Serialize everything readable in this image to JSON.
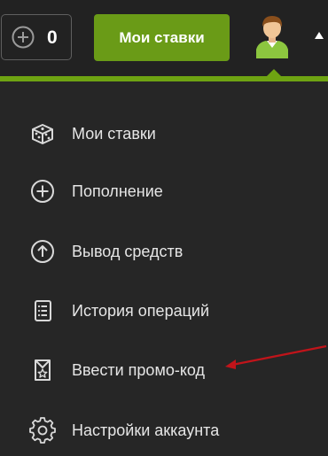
{
  "header": {
    "balance_value": "0",
    "add_funds_icon": "plus-circle-icon",
    "bets_button_label": "Мои ставки",
    "avatar_icon": "user-avatar-icon",
    "dropdown_icon": "caret-up-icon"
  },
  "colors": {
    "accent_green": "#6a9b17",
    "background": "#262626",
    "annotation_arrow": "#c0141a"
  },
  "menu": {
    "items": [
      {
        "label": "Мои ставки",
        "icon": "dice-icon"
      },
      {
        "label": "Пополнение",
        "icon": "plus-circle-icon"
      },
      {
        "label": "Вывод средств",
        "icon": "arrow-up-circle-icon"
      },
      {
        "label": "История операций",
        "icon": "document-list-icon"
      },
      {
        "label": "Ввести промо-код",
        "icon": "star-badge-icon"
      },
      {
        "label": "Настройки аккаунта",
        "icon": "gear-icon"
      }
    ]
  }
}
